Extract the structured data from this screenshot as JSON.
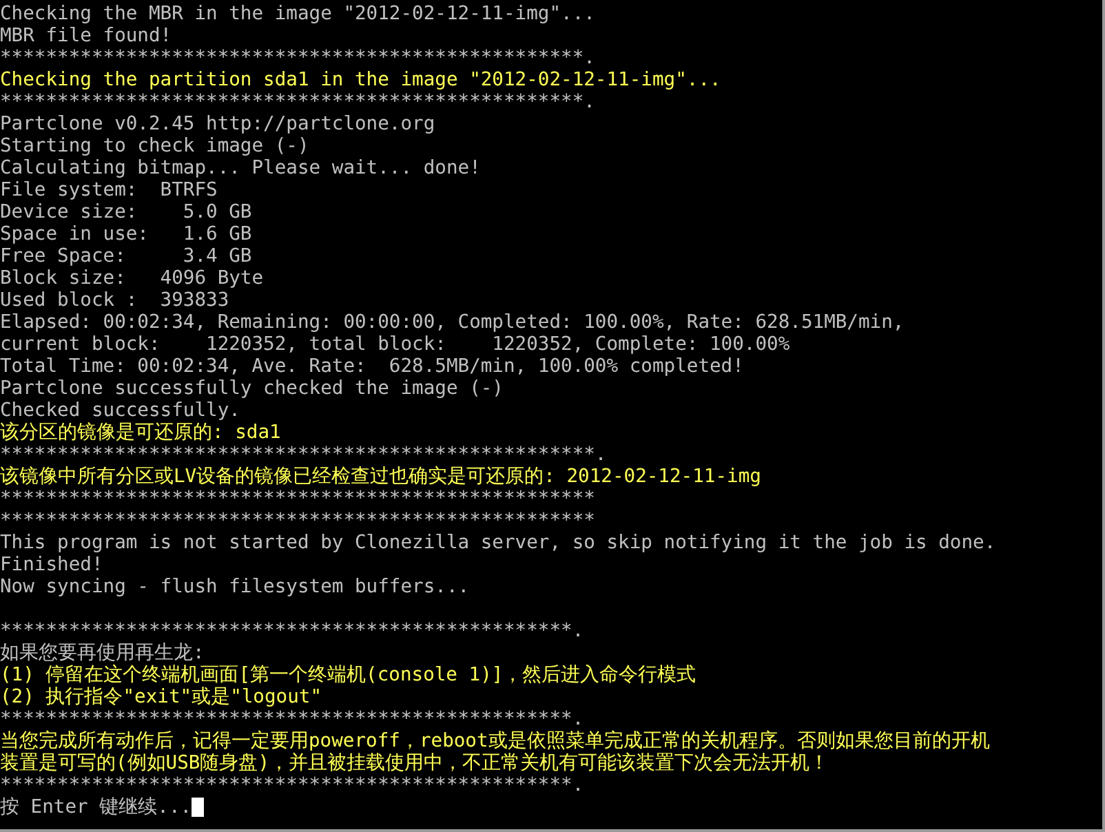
{
  "terminal": {
    "lines": [
      {
        "kind": "line",
        "text": "Checking the MBR in the image \"2012-02-12-11-img\"...",
        "color": "#c0c0c0"
      },
      {
        "kind": "line",
        "text": "MBR file found!",
        "color": "#c0c0c0"
      },
      {
        "kind": "line",
        "text": "***************************************************.",
        "color": "#c0c0c0"
      },
      {
        "kind": "line",
        "text": "Checking the partition sda1 in the image \"2012-02-12-11-img\"...",
        "color": "#ffff55"
      },
      {
        "kind": "line",
        "text": "***************************************************.",
        "color": "#c0c0c0"
      },
      {
        "kind": "line",
        "text": "Partclone v0.2.45 http://partclone.org",
        "color": "#c0c0c0"
      },
      {
        "kind": "line",
        "text": "Starting to check image (-)",
        "color": "#c0c0c0"
      },
      {
        "kind": "line",
        "text": "Calculating bitmap... Please wait... done!",
        "color": "#c0c0c0"
      },
      {
        "kind": "line",
        "text": "File system:  BTRFS",
        "color": "#c0c0c0"
      },
      {
        "kind": "line",
        "text": "Device size:    5.0 GB",
        "color": "#c0c0c0"
      },
      {
        "kind": "line",
        "text": "Space in use:   1.6 GB",
        "color": "#c0c0c0"
      },
      {
        "kind": "line",
        "text": "Free Space:     3.4 GB",
        "color": "#c0c0c0"
      },
      {
        "kind": "line",
        "text": "Block size:   4096 Byte",
        "color": "#c0c0c0"
      },
      {
        "kind": "line",
        "text": "Used block :  393833",
        "color": "#c0c0c0"
      },
      {
        "kind": "line",
        "text": "Elapsed: 00:02:34, Remaining: 00:00:00, Completed: 100.00%, Rate: 628.51MB/min,",
        "color": "#c0c0c0"
      },
      {
        "kind": "line",
        "text": "current block:    1220352, total block:    1220352, Complete: 100.00%",
        "color": "#c0c0c0"
      },
      {
        "kind": "line",
        "text": "Total Time: 00:02:34, Ave. Rate:  628.5MB/min, 100.00% completed!",
        "color": "#c0c0c0"
      },
      {
        "kind": "line",
        "text": "Partclone successfully checked the image (-)",
        "color": "#c0c0c0"
      },
      {
        "kind": "line",
        "text": "Checked successfully.",
        "color": "#c0c0c0"
      },
      {
        "kind": "line",
        "text": "该分区的镜像是可还原的: sda1",
        "color": "#ffff55"
      },
      {
        "kind": "line",
        "text": "****************************************************.",
        "color": "#c0c0c0"
      },
      {
        "kind": "line",
        "text": "该镜像中所有分区或LV设备的镜像已经检查过也确实是可还原的: 2012-02-12-11-img",
        "color": "#ffff55"
      },
      {
        "kind": "line",
        "text": "****************************************************",
        "color": "#c0c0c0"
      },
      {
        "kind": "line",
        "text": "****************************************************",
        "color": "#c0c0c0"
      },
      {
        "kind": "line",
        "text": "This program is not started by Clonezilla server, so skip notifying it the job is done.",
        "color": "#c0c0c0"
      },
      {
        "kind": "line",
        "text": "Finished!",
        "color": "#c0c0c0"
      },
      {
        "kind": "line",
        "text": "Now syncing - flush filesystem buffers...",
        "color": "#c0c0c0"
      },
      {
        "kind": "blank"
      },
      {
        "kind": "line",
        "text": "**************************************************.",
        "color": "#c0c0c0"
      },
      {
        "kind": "line",
        "text": "如果您要再使用再生龙:",
        "color": "#c0c0c0"
      },
      {
        "kind": "line",
        "text": "(1) 停留在这个终端机画面[第一个终端机(console 1)]，然后进入命令行模式",
        "color": "#ffff55"
      },
      {
        "kind": "line",
        "text": "(2) 执行指令\"exit\"或是\"logout\"",
        "color": "#ffff55"
      },
      {
        "kind": "line",
        "text": "**************************************************.",
        "color": "#c0c0c0"
      },
      {
        "kind": "line",
        "text": "当您完成所有动作后，记得一定要用poweroff，reboot或是依照菜单完成正常的关机程序。否则如果您目前的开机",
        "color": "#ffff55"
      },
      {
        "kind": "line",
        "text": "装置是可写的(例如USB随身盘)，并且被挂载使用中，不正常关机有可能该装置下次会无法开机！",
        "color": "#ffff55"
      },
      {
        "kind": "line",
        "text": "**************************************************.",
        "color": "#c0c0c0"
      },
      {
        "kind": "prompt",
        "text": "按 Enter 键继续...",
        "color": "#c0c0c0"
      }
    ]
  }
}
